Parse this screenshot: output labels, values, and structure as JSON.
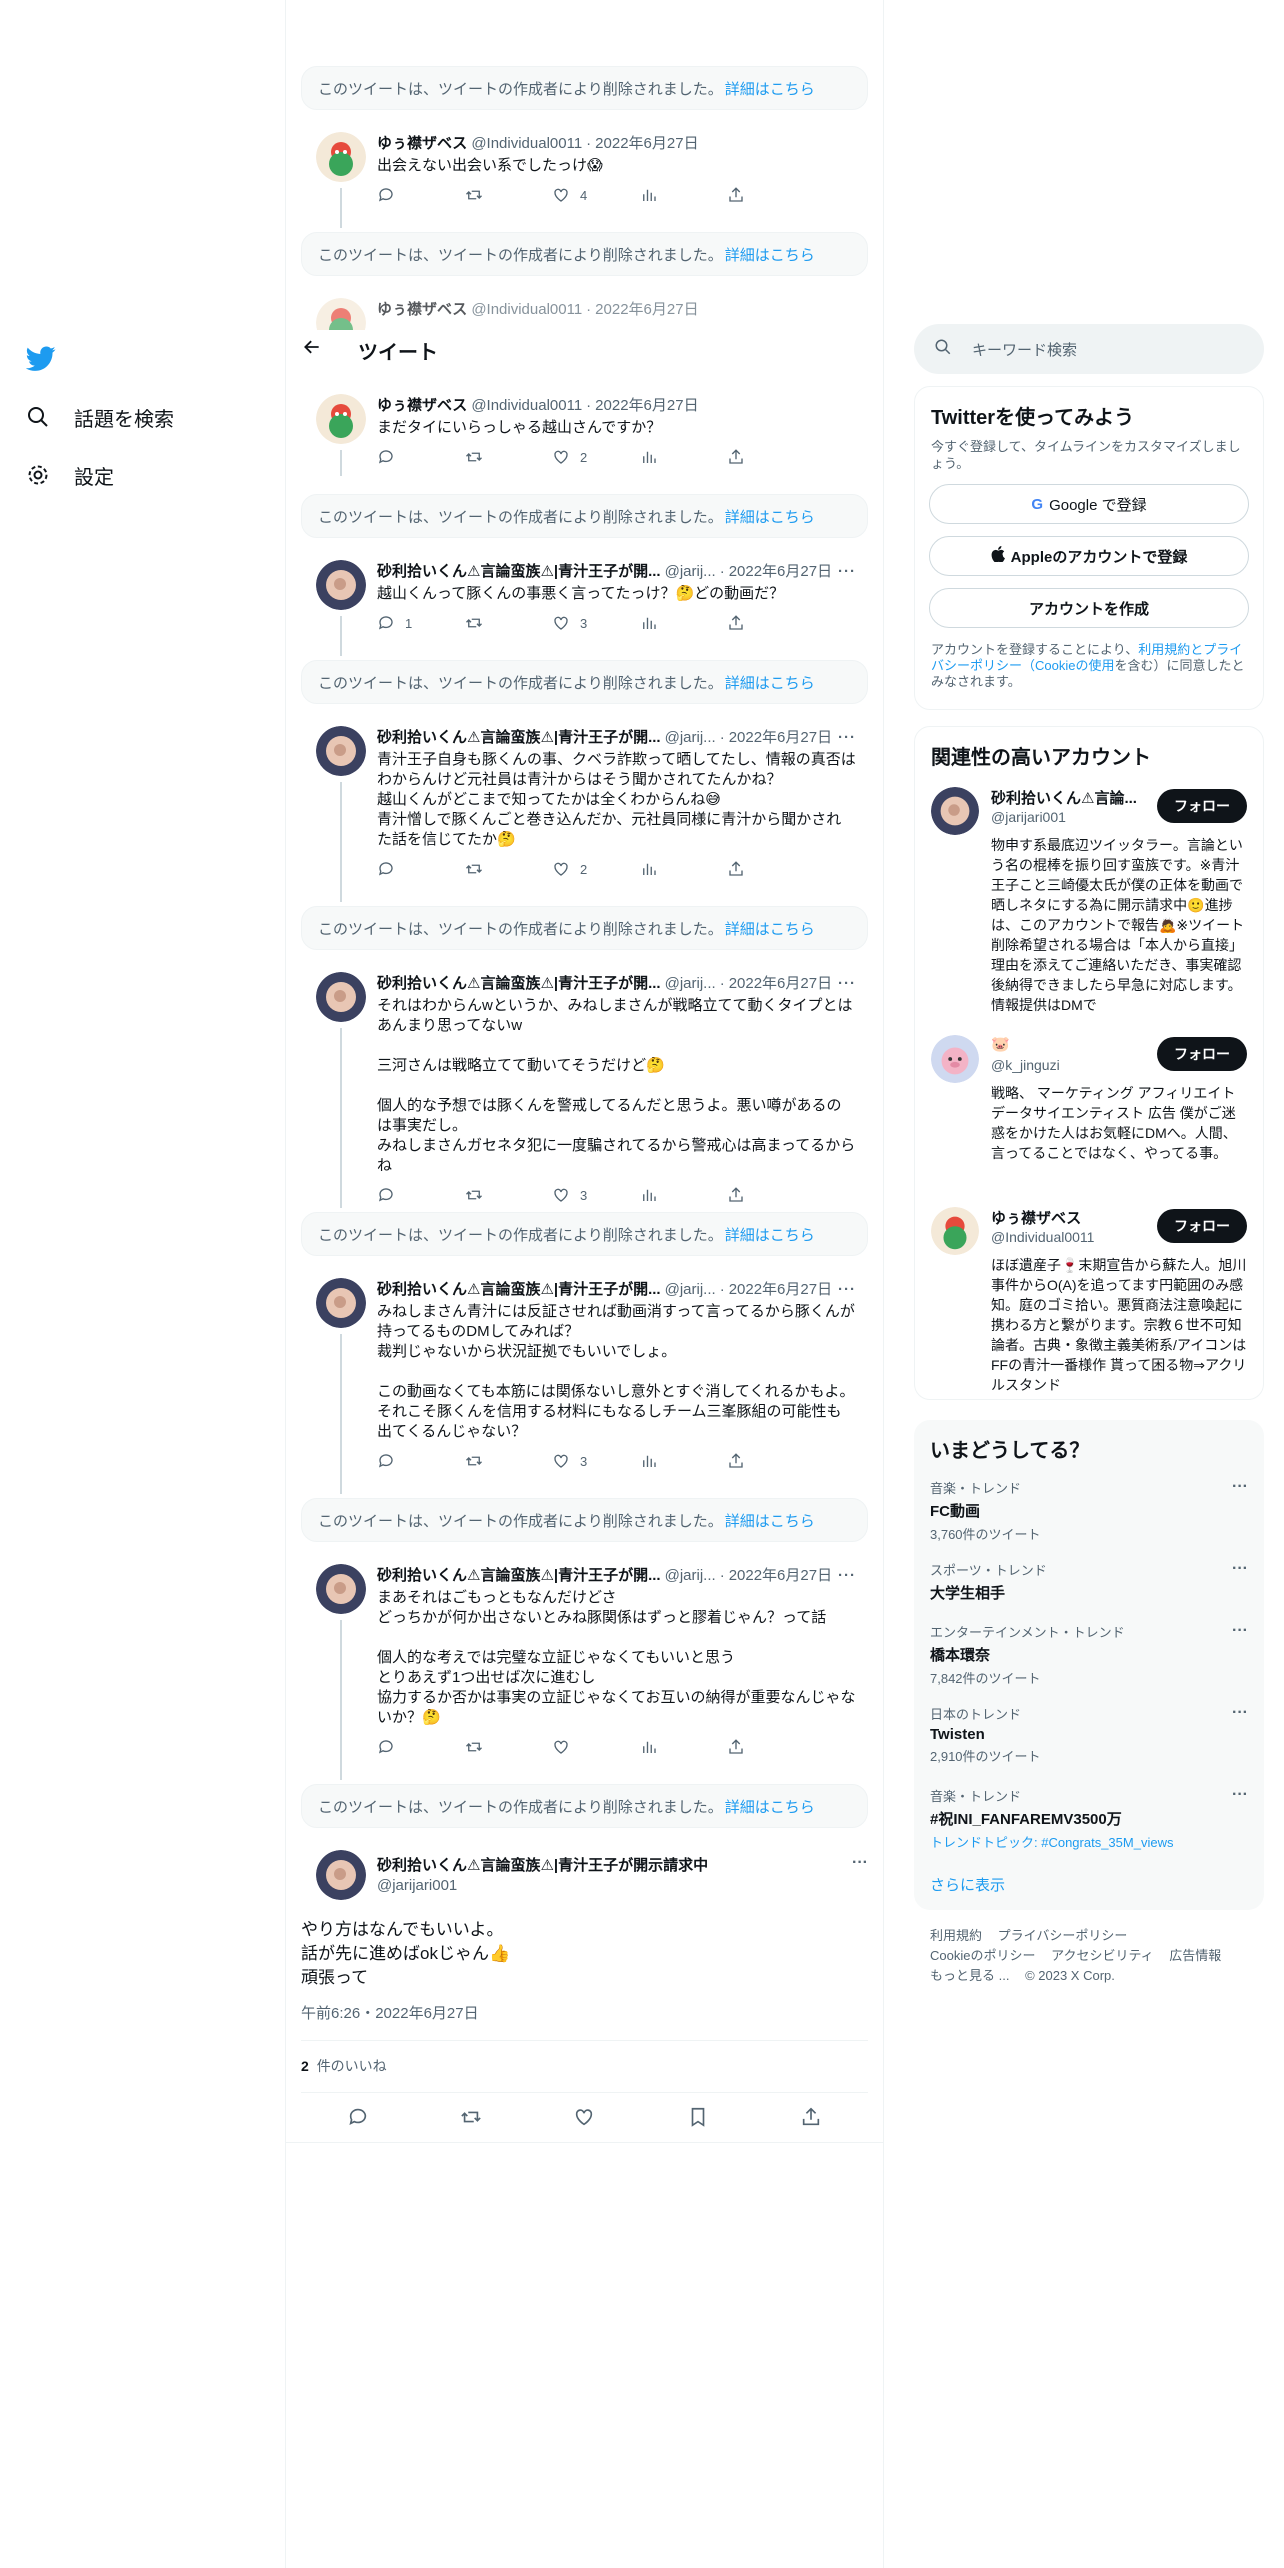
{
  "nav": {
    "logo_icon": "twitter-bird-icon",
    "explore_label": "話題を検索",
    "settings_label": "設定"
  },
  "header": {
    "back_icon": "arrow-left-icon",
    "title": "ツイート"
  },
  "deleted_notice": {
    "text": "このツイートは、ツイートの作成者により削除されました。",
    "link": "詳細はこちら"
  },
  "thread": {
    "tweet1": {
      "name": "ゆぅ襟ザベス",
      "handle": "@Individual0011",
      "date": "2022年6月27日",
      "text": "出会えない出会い系でしたっけ😱",
      "replies": "",
      "retweets": "",
      "likes": "4"
    },
    "tweet2_partial": {
      "name": "ゆぅ襟ザベス",
      "handle": "@Individual0011",
      "date": "2022年6月27日"
    },
    "tweet3": {
      "name": "ゆぅ襟ザベス",
      "handle": "@Individual0011",
      "date": "2022年6月27日",
      "text": "まだタイにいらっしゃる越山さんですか？",
      "likes": "2"
    },
    "tweet4": {
      "name": "砂利拾いくん⚠言論蛮族⚠|青汁王子が開...",
      "handle": "@jarij...",
      "date": "2022年6月27日",
      "text": "越山くんって豚くんの事悪く言ってたっけ？🤔どの動画だ？",
      "replies": "1",
      "likes": "3"
    },
    "tweet5": {
      "name": "砂利拾いくん⚠言論蛮族⚠|青汁王子が開...",
      "handle": "@jarij...",
      "date": "2022年6月27日",
      "text": "青汁王子自身も豚くんの事、クベラ詐欺って晒してたし、情報の真否はわからんけど元社員は青汁からはそう聞かされてたんかね？\n越山くんがどこまで知ってたかは全くわからんね😅\n青汁憎しで豚くんごと巻き込んだか、元社員同様に青汁から聞かされた話を信じてたか🤔",
      "likes": "2"
    },
    "tweet6": {
      "name": "砂利拾いくん⚠言論蛮族⚠|青汁王子が開...",
      "handle": "@jarij...",
      "date": "2022年6月27日",
      "text": "それはわからんwというか、みねしまさんが戦略立てて動くタイプとはあんまり思ってないw\n\n三河さんは戦略立てて動いてそうだけど🤔\n\n個人的な予想では豚くんを警戒してるんだと思うよ。悪い噂があるのは事実だし。\nみねしまさんガセネタ犯に一度騙されてるから警戒心は高まってるからね",
      "likes": "3"
    },
    "tweet7": {
      "name": "砂利拾いくん⚠言論蛮族⚠|青汁王子が開...",
      "handle": "@jarij...",
      "date": "2022年6月27日",
      "text": "みねしまさん青汁には反証させれば動画消すって言ってるから豚くんが持ってるものDMしてみれば？\n裁判じゃないから状況証拠でもいいでしょ。\n\nこの動画なくても本筋には関係ないし意外とすぐ消してくれるかもよ。\nそれこそ豚くんを信用する材料にもなるしチーム三峯豚組の可能性も出てくるんじゃない？",
      "likes": "3"
    },
    "tweet8": {
      "name": "砂利拾いくん⚠言論蛮族⚠|青汁王子が開...",
      "handle": "@jarij...",
      "date": "2022年6月27日",
      "text": "まあそれはごもっともなんだけどさ\nどっちかが何か出さないとみね豚関係はずっと膠着じゃん？って話\n\n個人的な考えでは完璧な立証じゃなくてもいいと思う\nとりあえず1つ出せば次に進むし\n協力するか否かは事実の立証じゃなくてお互いの納得が重要なんじゃないか？🤔",
      "likes": ""
    }
  },
  "main_tweet": {
    "name": "砂利拾いくん⚠言論蛮族⚠|青汁王子が開示請求中",
    "handle": "@jarijari001",
    "text": "やり方はなんでもいいよ。\n話が先に進めばokじゃん👍\n頑張って",
    "timestamp": "午前6:26・2022年6月27日",
    "likes_count": "2",
    "likes_label": "件のいいね"
  },
  "sidebar": {
    "search_placeholder": "キーワード検索",
    "signup": {
      "title": "Twitterを使ってみよう",
      "subtitle": "今すぐ登録して、タイムラインをカスタマイズしましょう。",
      "google": "Google で登録",
      "apple": "Appleのアカウントで登録",
      "create": "アカウントを作成",
      "terms_pre": "アカウントを登録することにより、",
      "terms_link": "利用規約とプライバシーポリシー（Cookieの使用",
      "terms_post": "を含む）に同意したとみなされます。"
    },
    "relevant": {
      "title": "関連性の高いアカウント",
      "follow_label": "フォロー",
      "accounts": [
        {
          "name": "砂利拾いくん⚠言論...",
          "handle": "@jarijari001",
          "bio": "物申す系最底辺ツイッタラー。言論という名の棍棒を振り回す蛮族です。※青汁王子こと三崎優太氏が僕の正体を動画で晒しネタにする為に開示請求中🙂進捗は、このアカウントで報告🙇※ツイート削除希望される場合は「本人から直接」理由を添えてご連絡いただき、事実確認後納得できましたら早急に対応します。情報提供はDMで"
        },
        {
          "name": "🐷",
          "handle": "@k_jinguzi",
          "bio": "戦略、 マーケティング アフィリエイト データサイエンティスト 広告 僕がご迷惑をかけた人はお気軽にDMへ。人間、言ってることではなく、やってる事。"
        },
        {
          "name": "ゆぅ襟ザベス",
          "handle": "@Individual0011",
          "bio": "ほぼ遺産子🍷末期宣告から蘇た人。旭川事件からO(A)を追ってます円範囲のみ感知。庭のゴミ拾い。悪質商法注意喚起に携わる方と繋がります。宗教６世不可知論者。古典・象徴主義美術系/アイコンはFFの青汁一番様作 貰って困る物⇒アクリルスタンド"
        }
      ]
    },
    "trends": {
      "title": "いまどうしてる？",
      "items": [
        {
          "category": "音楽・トレンド",
          "name": "FC動画",
          "count": "3,760件のツイート"
        },
        {
          "category": "スポーツ・トレンド",
          "name": "大学生相手",
          "count": ""
        },
        {
          "category": "エンターテインメント・トレンド",
          "name": "橋本環奈",
          "count": "7,842件のツイート"
        },
        {
          "category": "日本のトレンド",
          "name": "Twisten",
          "count": "2,910件のツイート"
        },
        {
          "category": "音楽・トレンド",
          "name": "#祝INI_FANFAREMV3500万",
          "count": "トレンドトピック: #Congrats_35M_views"
        }
      ],
      "show_more": "さらに表示"
    },
    "footer": {
      "links": [
        "利用規約",
        "プライバシーポリシー",
        "Cookieのポリシー",
        "アクセシビリティ",
        "広告情報",
        "もっと見る ..."
      ],
      "copyright": "© 2023 X Corp."
    }
  }
}
